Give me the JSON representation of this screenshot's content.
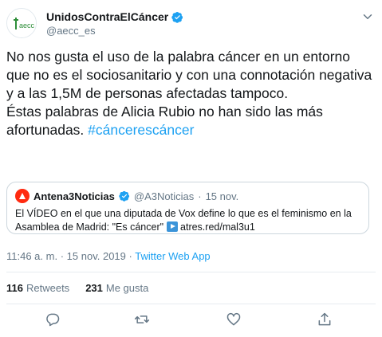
{
  "author": {
    "display_name": "UnidosContraElCáncer",
    "handle": "@aecc_es",
    "avatar_text": "aecc"
  },
  "tweet": {
    "text_main": "No nos gusta el uso de  la palabra cáncer en un entorno que no es el sociosanitario y con una connotación negativa y a las 1,5M  de personas afectadas tampoco.\nÉstas palabras de Alicia Rubio no han sido las más afortunadas. ",
    "hashtag": "#cáncerescáncer"
  },
  "quote": {
    "name": "Antena3Noticias",
    "handle": "@A3Noticias",
    "dot": "·",
    "date": "15 nov.",
    "text": "El VÍDEO en el que una diputada de Vox define lo que es el feminismo en la Asamblea de Madrid: \"Es cáncer\"",
    "link": "atres.red/mal3u1"
  },
  "meta": {
    "time": "11:46 a. m.",
    "sep": "·",
    "date": "15 nov. 2019",
    "source": "Twitter Web App"
  },
  "stats": {
    "retweets_count": "116",
    "retweets_label": "Retweets",
    "likes_count": "231",
    "likes_label": "Me gusta"
  },
  "icons": [
    "verified-badge-icon",
    "chevron-down-icon",
    "reply-icon",
    "retweet-icon",
    "like-icon",
    "share-icon"
  ],
  "colors": {
    "accent": "#1da1f2",
    "secondary_text": "#657786",
    "border": "#ccd6dd",
    "aecc_green": "#2f8f3a"
  }
}
